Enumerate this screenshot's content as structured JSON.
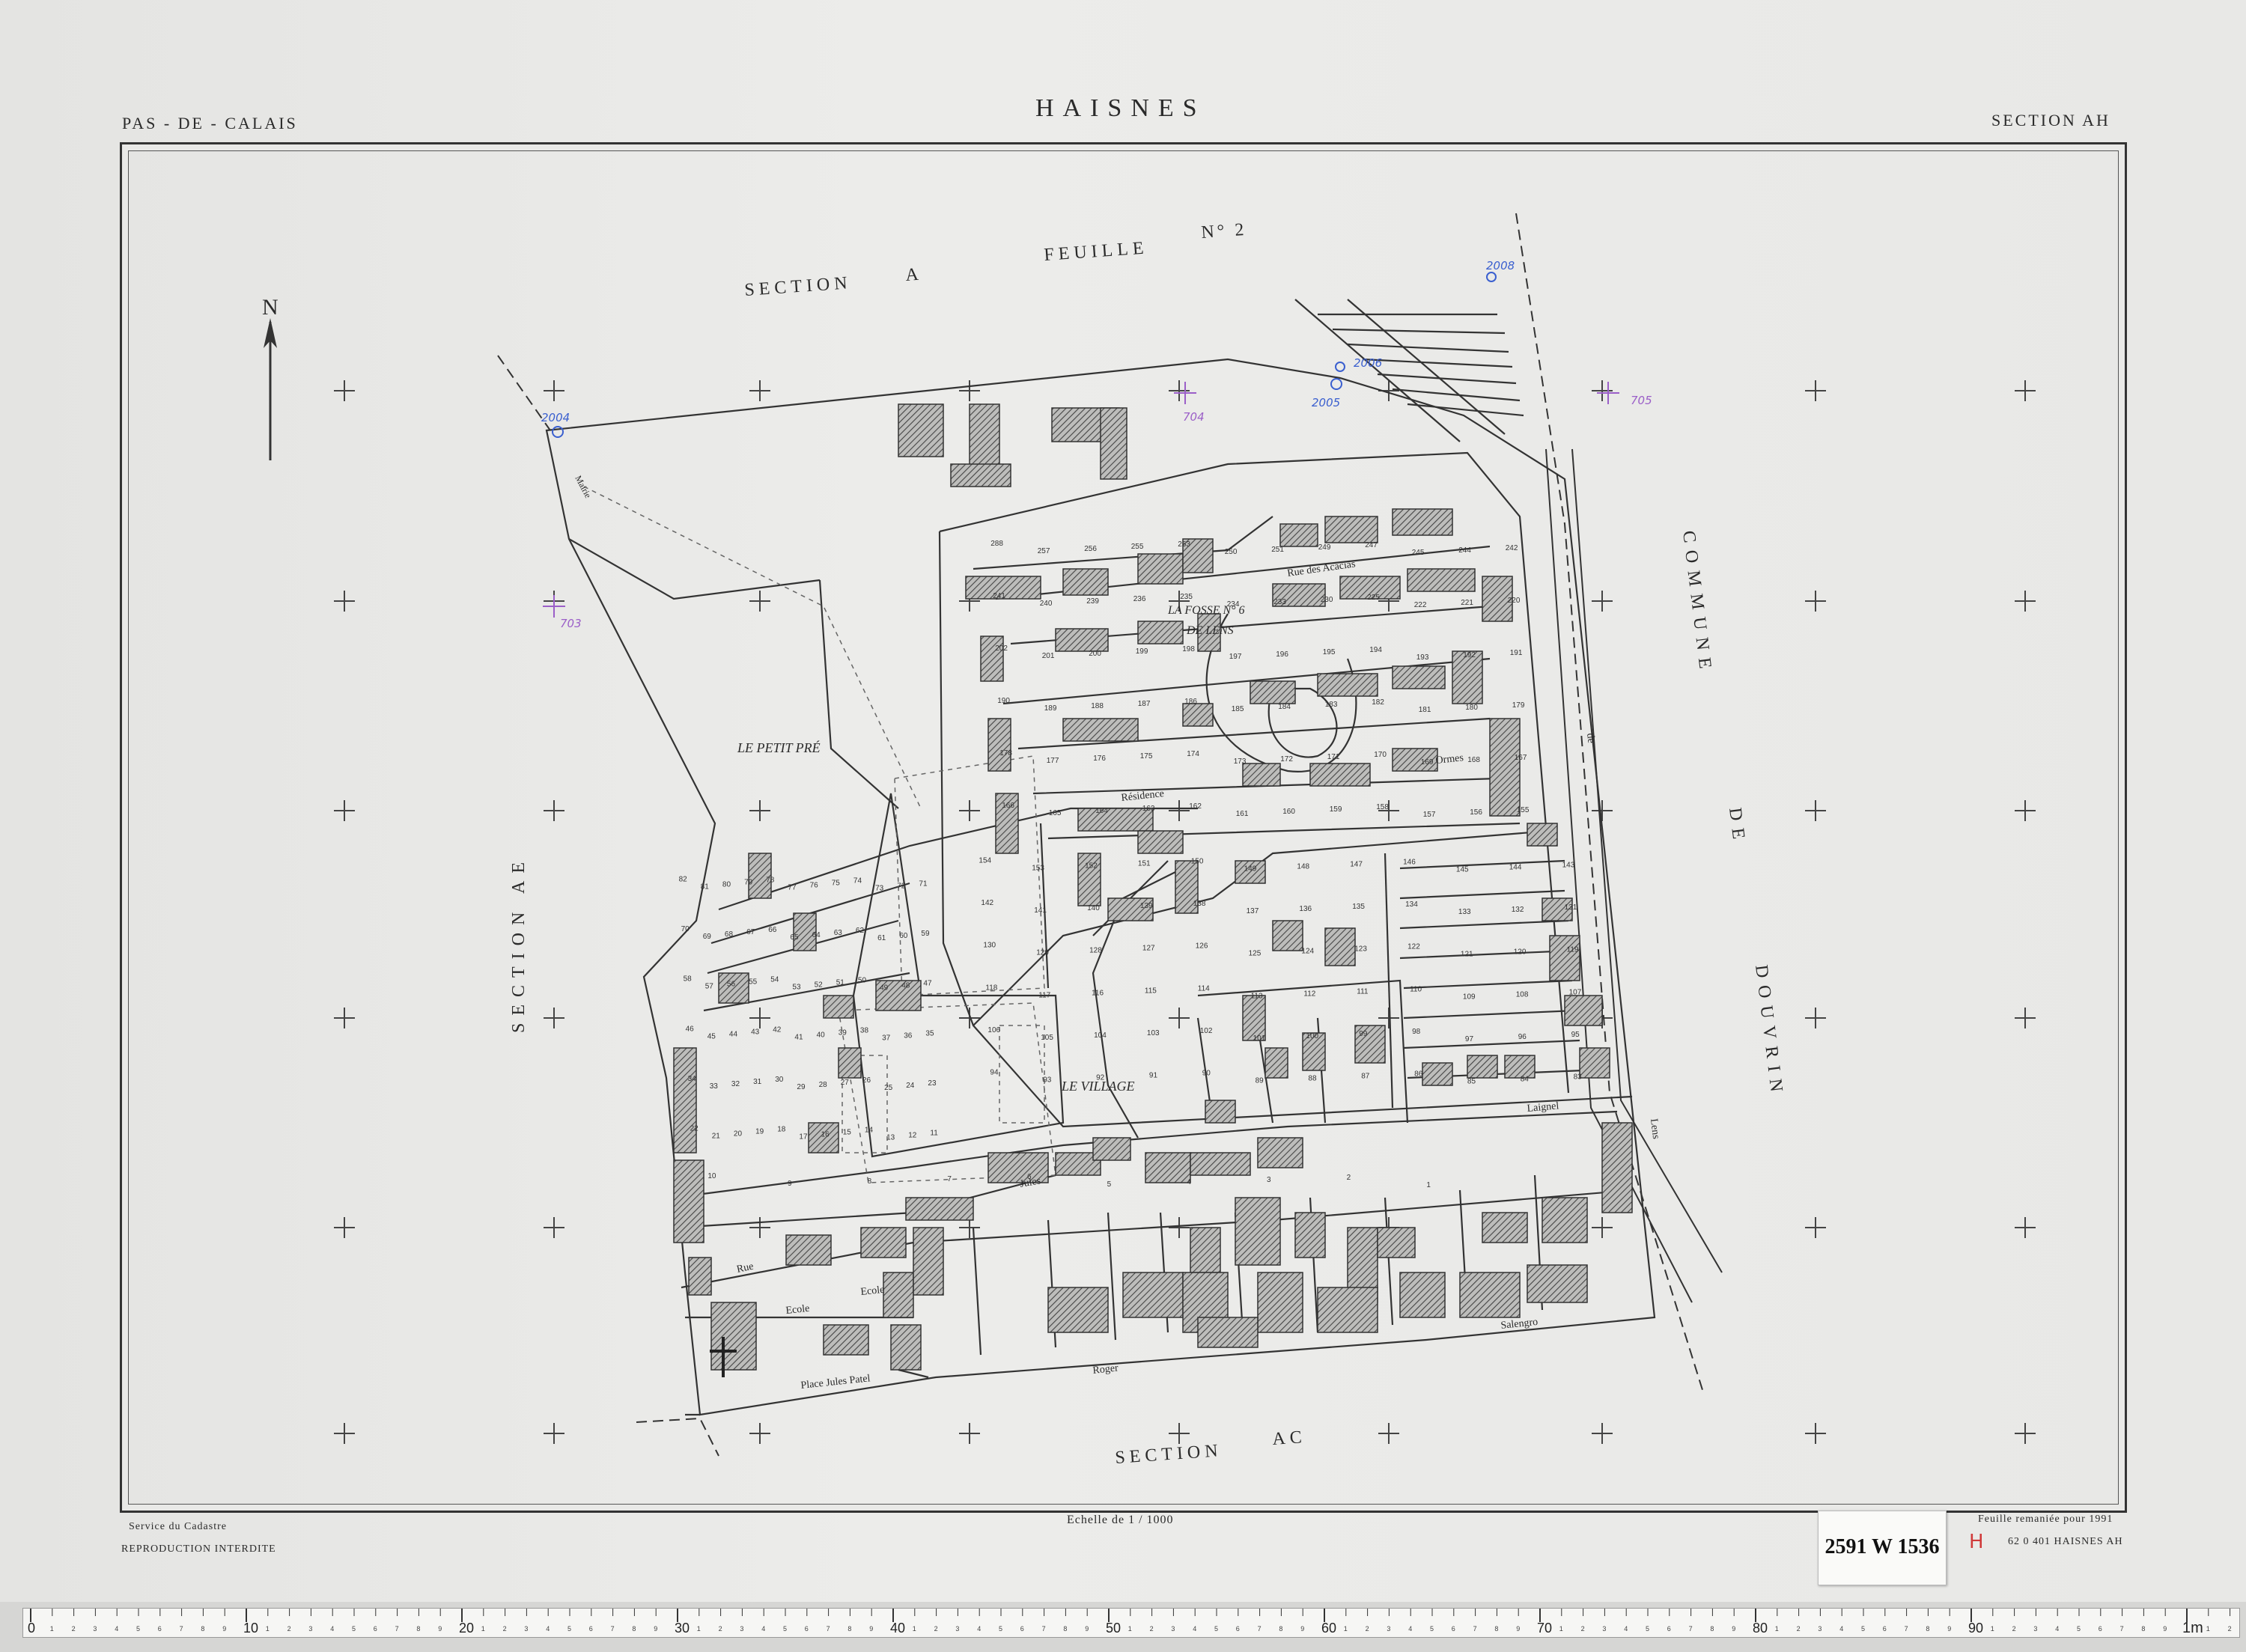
{
  "header": {
    "department": "PAS - DE - CALAIS",
    "commune": "HAISNES",
    "section": "SECTION AH"
  },
  "map_labels": {
    "north": "N",
    "section_a": "SECTION",
    "section_a_letter": "A",
    "feuille": "FEUILLE",
    "feuille_no": "N° 2",
    "section_ae": "SECTION AE",
    "section_ac": "SECTION",
    "section_ac_letter": "AC",
    "commune": "COMMUNE",
    "de": "DE",
    "douvrin": "DOUVRIN",
    "petit_pre": "LE PETIT PRÉ",
    "fosse": "LA FOSSE N° 6",
    "de_lens": "DE LENS",
    "village": "LE VILLAGE",
    "rue_acacias": "Rue des Acacias",
    "rue_residence": "Résidence",
    "ormes": "Ormes",
    "jules": "Jules",
    "rue": "Rue",
    "ecole1": "Ecole",
    "ecole2": "Ecole",
    "place": "Place Jules Patel",
    "roger": "Roger",
    "salengro": "Salengro",
    "route_lens": "Lens",
    "laignel": "Laignel",
    "mairie": "Mairie",
    "rue_de": "de"
  },
  "annotations": {
    "a2004": "2004",
    "a2005": "2005",
    "a2006": "2006",
    "a2008": "2008",
    "a703": "703",
    "a704": "704",
    "a705": "705"
  },
  "parcels": [
    "288",
    "257",
    "256",
    "255",
    "253",
    "250",
    "251",
    "249",
    "247",
    "245",
    "244",
    "242",
    "241",
    "240",
    "239",
    "236",
    "235",
    "234",
    "233",
    "230",
    "225",
    "222",
    "221",
    "220",
    "202",
    "201",
    "200",
    "199",
    "198",
    "197",
    "196",
    "195",
    "194",
    "193",
    "192",
    "191",
    "190",
    "189",
    "188",
    "187",
    "186",
    "185",
    "184",
    "183",
    "182",
    "181",
    "180",
    "179",
    "178",
    "177",
    "176",
    "175",
    "174",
    "173",
    "172",
    "171",
    "170",
    "169",
    "168",
    "167",
    "166",
    "165",
    "164",
    "163",
    "162",
    "161",
    "160",
    "159",
    "158",
    "157",
    "156",
    "155",
    "154",
    "153",
    "152",
    "151",
    "150",
    "149",
    "148",
    "147",
    "146",
    "145",
    "144",
    "143",
    "142",
    "141",
    "140",
    "139",
    "138",
    "137",
    "136",
    "135",
    "134",
    "133",
    "132",
    "131",
    "130",
    "129",
    "128",
    "127",
    "126",
    "125",
    "124",
    "123",
    "122",
    "121",
    "120",
    "119",
    "118",
    "117",
    "116",
    "115",
    "114",
    "113",
    "112",
    "111",
    "110",
    "109",
    "108",
    "107",
    "106",
    "105",
    "104",
    "103",
    "102",
    "101",
    "100",
    "99",
    "98",
    "97",
    "96",
    "95",
    "94",
    "93",
    "92",
    "91",
    "90",
    "89",
    "88",
    "87",
    "86",
    "85",
    "84",
    "83",
    "82",
    "81",
    "80",
    "79",
    "78",
    "77",
    "76",
    "75",
    "74",
    "73",
    "72",
    "71",
    "70",
    "69",
    "68",
    "67",
    "66",
    "65",
    "64",
    "63",
    "62",
    "61",
    "60",
    "59",
    "58",
    "57",
    "56",
    "55",
    "54",
    "53",
    "52",
    "51",
    "50",
    "49",
    "48",
    "47",
    "46",
    "45",
    "44",
    "43",
    "42",
    "41",
    "40",
    "39",
    "38",
    "37",
    "36",
    "35",
    "34",
    "33",
    "32",
    "31",
    "30",
    "29",
    "28",
    "27",
    "26",
    "25",
    "24",
    "23",
    "22",
    "21",
    "20",
    "19",
    "18",
    "17",
    "16",
    "15",
    "14",
    "13",
    "12",
    "11",
    "10",
    "9",
    "8",
    "7",
    "6",
    "5",
    "4",
    "3",
    "2",
    "1"
  ],
  "footer": {
    "service": "Service du Cadastre",
    "reproduction": "REPRODUCTION INTERDITE",
    "scale": "Echelle de 1 / 1000",
    "remaniee": "Feuille remaniée pour 1991",
    "code": "62 0 401 HAISNES AH",
    "archive": "2591 W 1536",
    "h_mark": "H"
  },
  "ruler": {
    "unit_label": "1m",
    "ticks_dm": [
      "0",
      "10",
      "20",
      "30",
      "40",
      "50",
      "60",
      "70",
      "80",
      "90"
    ]
  },
  "colors": {
    "ink": "#2a2a2a",
    "hatch": "#555555",
    "blue_annotation": "#3a5fcf",
    "purple_annotation": "#9b5fc8",
    "red_mark": "#d03a3a"
  }
}
